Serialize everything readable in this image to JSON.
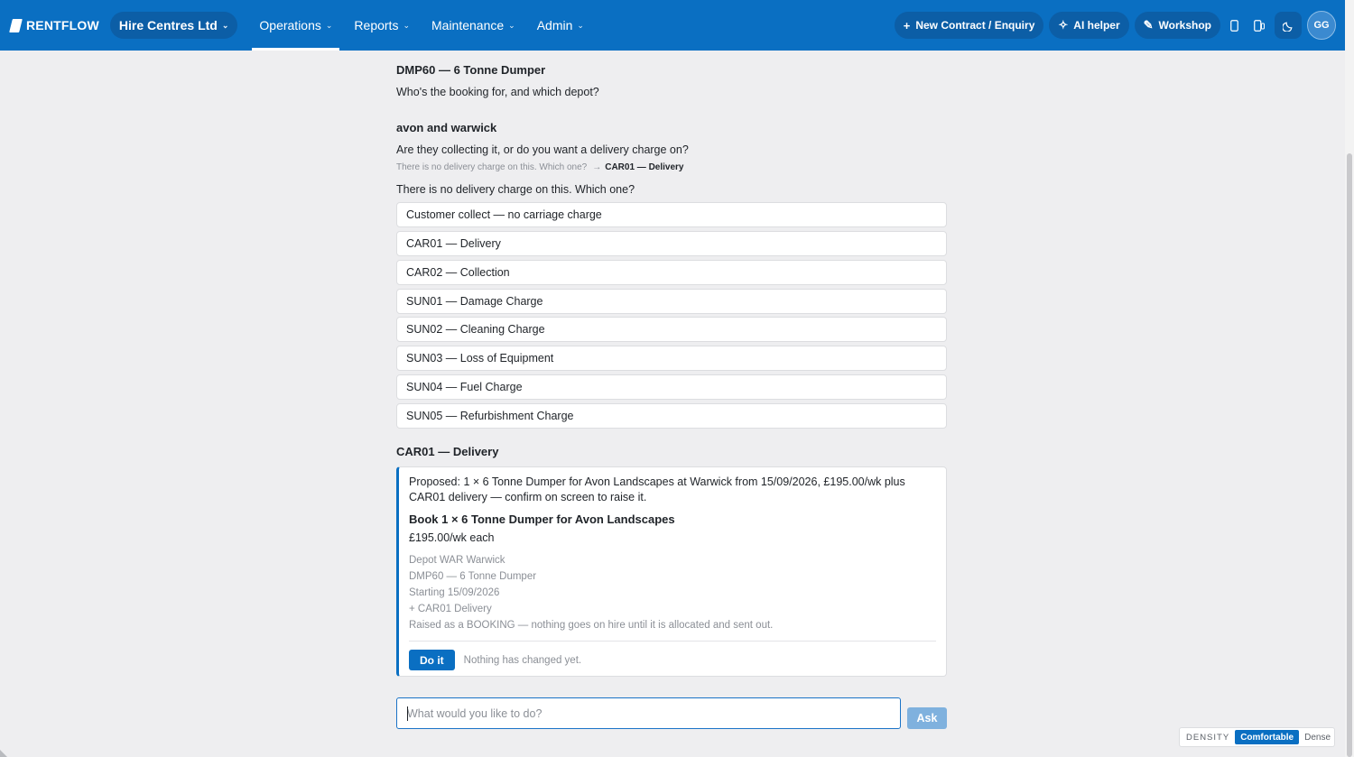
{
  "app": {
    "logo_text": "RENTFLOW",
    "company": "Hire Centres Ltd",
    "nav": [
      {
        "label": "Operations",
        "active": true
      },
      {
        "label": "Reports",
        "active": false
      },
      {
        "label": "Maintenance",
        "active": false
      },
      {
        "label": "Admin",
        "active": false
      }
    ],
    "actions": {
      "new_contract": "New Contract / Enquiry",
      "ai_helper": "AI helper",
      "workshop": "Workshop"
    },
    "avatar_initials": "GG",
    "icons": {
      "plus": "plus-icon",
      "sparkle": "sparkle-icon",
      "wrench": "wrench-icon",
      "mobile": "mobile-icon",
      "tablet": "tablet-icon",
      "moon": "moon-icon",
      "chevron": "chevron-down-icon"
    },
    "brand_color": "#0a6fc2"
  },
  "conversation": {
    "msg1_user": "DMP60 — 6 Tonne Dumper",
    "msg1_bot": "Who's the booking for, and which depot?",
    "msg2_user": "avon and warwick",
    "msg2_bot": "Are they collecting it, or do you want a delivery charge on?",
    "trace_text": "There is no delivery charge on this. Which one?",
    "trace_arrow": "→",
    "trace_pick": "CAR01 — Delivery",
    "question": "There is no delivery charge on this. Which one?",
    "options": [
      "Customer collect — no carriage charge",
      "CAR01 — Delivery",
      "CAR02 — Collection",
      "SUN01 — Damage Charge",
      "SUN02 — Cleaning Charge",
      "SUN03 — Loss of Equipment",
      "SUN04 — Fuel Charge",
      "SUN05 — Refurbishment Charge"
    ],
    "msg3_user": "CAR01 — Delivery"
  },
  "proposal": {
    "text": "Proposed: 1 × 6 Tonne Dumper for Avon Landscapes at Warwick from 15/09/2026, £195.00/wk plus CAR01 delivery — confirm on screen to raise it.",
    "title": "Book 1 × 6 Tonne Dumper for Avon Landscapes",
    "price": "£195.00/wk each",
    "details": [
      "Depot WAR Warwick",
      "DMP60 — 6 Tonne Dumper",
      "Starting 15/09/2026",
      "+ CAR01 Delivery",
      "Raised as a BOOKING — nothing goes on hire until it is allocated and sent out."
    ],
    "do_label": "Do it",
    "status": "Nothing has changed yet."
  },
  "input": {
    "placeholder": "What would you like to do?",
    "ask_label": "Ask"
  },
  "density": {
    "label": "DENSITY",
    "comfortable": "Comfortable",
    "dense": "Dense",
    "selected": "Comfortable"
  }
}
